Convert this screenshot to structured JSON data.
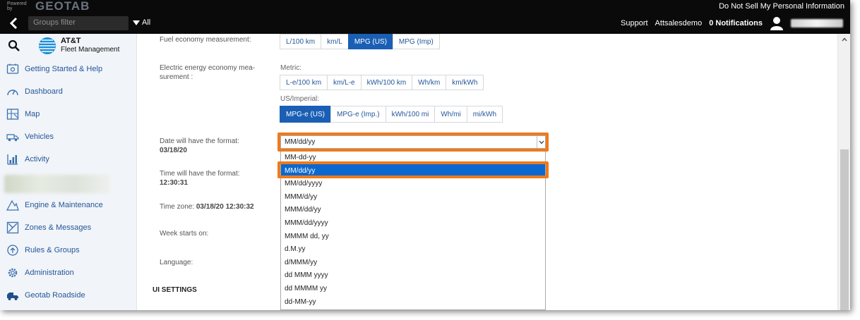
{
  "topbar": {
    "powered_by": "Powered by",
    "brand": "GEOTAB",
    "do_not_sell": "Do Not Sell My Personal Information",
    "groups_placeholder": "Groups filter",
    "all_label": "All",
    "support": "Support",
    "account": "Attsalesdemo",
    "notifications": "0 Notifications"
  },
  "sidebar": {
    "logo_name": "AT&T",
    "logo_sub": "Fleet Management",
    "items": [
      {
        "label": "Getting Started & Help",
        "icon": "help-box-icon"
      },
      {
        "label": "Dashboard",
        "icon": "gauge-icon"
      },
      {
        "label": "Map",
        "icon": "map-icon"
      },
      {
        "label": "Vehicles",
        "icon": "truck-icon"
      },
      {
        "label": "Activity",
        "icon": "bar-chart-icon"
      },
      {
        "label": "Engine & Maintenance",
        "icon": "engine-icon"
      },
      {
        "label": "Zones & Messages",
        "icon": "zones-icon"
      },
      {
        "label": "Rules & Groups",
        "icon": "rules-icon"
      },
      {
        "label": "Administration",
        "icon": "gear-icon"
      },
      {
        "label": "Geotab Roadside",
        "icon": "tow-truck-icon"
      }
    ]
  },
  "settings": {
    "fuel_label": "Fuel economy measurement:",
    "fuel_options": [
      "L/100 km",
      "km/L",
      "MPG (US)",
      "MPG (Imp)"
    ],
    "fuel_active": "MPG (US)",
    "electric_label_1": "Electric energy economy mea-",
    "electric_label_2": "surement :",
    "metric_label": "Metric:",
    "metric_options": [
      "L-e/100 km",
      "km/L-e",
      "kWh/100 km",
      "Wh/km",
      "km/kWh"
    ],
    "imperial_label": "US/Imperial:",
    "imperial_options": [
      "MPG-e (US)",
      "MPG-e (Imp.)",
      "kWh/100 mi",
      "Wh/mi",
      "mi/kWh"
    ],
    "imperial_active": "MPG-e (US)",
    "date_label": "Date will have the format:",
    "date_value": "03/18/20",
    "date_selected": "MM/dd/yy",
    "time_label": "Time will have the format:",
    "time_value": "12:30:31",
    "timezone_label": "Time zone:",
    "timezone_value": "03/18/20 12:30:32",
    "week_label": "Week starts on:",
    "language_label": "Language:",
    "ui_settings": "UI SETTINGS"
  },
  "date_options": [
    "MM-dd-yy",
    "MM/dd/yy",
    "MM/dd/yyyy",
    "MMM/d/yy",
    "MMM/dd/yy",
    "MMM/dd/yyyy",
    "MMMM dd, yy",
    "d.M.yy",
    "d/MMM/yy",
    "dd MMM yyyy",
    "dd MMMM yy",
    "dd-MM-yy"
  ],
  "date_option_highlighted": "MM/dd/yy",
  "colors": {
    "accent": "#1a5fb4",
    "highlight_box": "#f07a1b",
    "nav_text": "#24579a"
  }
}
